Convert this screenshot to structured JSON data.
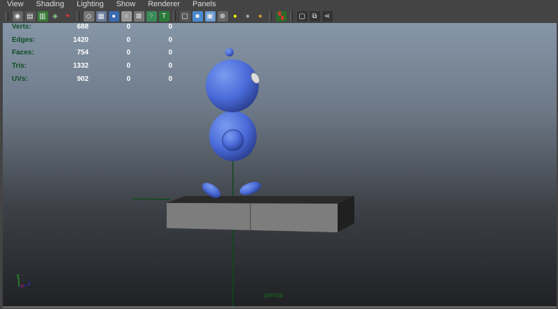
{
  "menu": [
    "View",
    "Shading",
    "Lighting",
    "Show",
    "Renderer",
    "Panels"
  ],
  "toolbar_icons": [
    "select-camera-icon",
    "camera-attributes-icon",
    "bookmarks-icon",
    "image-plane-icon",
    "2d-pan-zoom-icon",
    "grid-icon",
    "film-gate-icon",
    "resolution-gate-icon",
    "gate-mask-icon",
    "field-chart-icon",
    "safe-action-icon",
    "safe-title-icon",
    "wireframe-icon",
    "smooth-shade-icon",
    "wireframe-on-shaded-icon",
    "textured-icon",
    "use-all-lights-icon",
    "shadows-icon",
    "high-quality-icon",
    "isolate-select-icon",
    "xray-icon",
    "xray-joints-icon",
    "xray-components-icon"
  ],
  "hud": {
    "rows": [
      {
        "label": "Verts:",
        "values": [
          "688",
          "0",
          "0"
        ]
      },
      {
        "label": "Edges:",
        "values": [
          "1420",
          "0",
          "0"
        ]
      },
      {
        "label": "Faces:",
        "values": [
          "754",
          "0",
          "0"
        ]
      },
      {
        "label": "Tris:",
        "values": [
          "1332",
          "0",
          "0"
        ]
      },
      {
        "label": "UVs:",
        "values": [
          "902",
          "0",
          "0"
        ]
      }
    ]
  },
  "camera": "persp",
  "axis": {
    "x": "x",
    "y": "y",
    "z": "z"
  }
}
